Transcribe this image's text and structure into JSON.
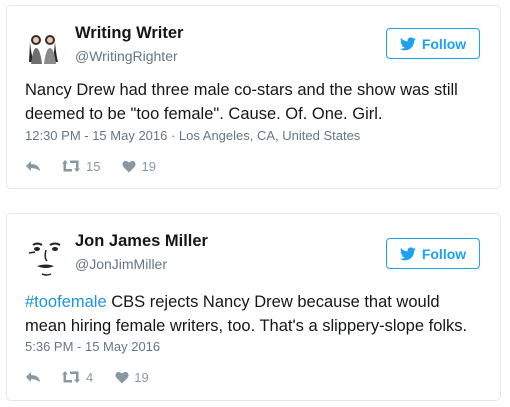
{
  "tweets": [
    {
      "name": "Writing Writer",
      "handle": "@WritingRighter",
      "follow_label": "Follow",
      "text": "Nancy Drew had three male co-stars and the show was still deemed to be \"too female\". Cause. Of. One. Girl.",
      "timestamp": "12:30 PM - 15 May 2016",
      "separator": " · ",
      "location": "Los Angeles, CA, United States",
      "retweets": "15",
      "likes": "19",
      "avatar_icon": "two-women-avatar-icon"
    },
    {
      "name": "Jon James Miller",
      "handle": "@JonJimMiller",
      "follow_label": "Follow",
      "hashtag": "#toofemale",
      "text_rest": " CBS rejects Nancy Drew because that would mean hiring female writers, too. That's a slippery-slope folks.",
      "timestamp": "5:36 PM - 15 May 2016",
      "retweets": "4",
      "likes": "19",
      "avatar_icon": "sketched-face-avatar-icon"
    }
  ],
  "colors": {
    "twitter_blue": "#1da1f2",
    "link_blue": "#1b95e0",
    "text": "#14171a",
    "secondary": "#657786",
    "icon_gray": "#8899a6",
    "border": "#e1e8ed"
  }
}
